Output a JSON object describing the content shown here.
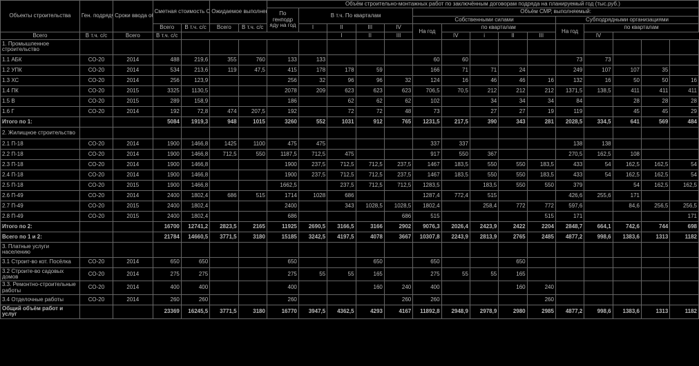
{
  "headers": {
    "obj": "Объекты строительства",
    "gen": "Ген. подрядчик",
    "srok": "Сроки ввода объектов в действие",
    "smeta": "Сметная стоимость СМР (тыс.руб.)",
    "ozhid": "Ожидаемое выполнение СМР на начало планового года",
    "vol_top": "Объём строительно-монтажных работ по заключённым договорам подряда на планируемый год (тыс.руб.)",
    "genpodr": "По генподр яду на год",
    "kvart": "В т.ч. По кварталам",
    "vol_vyp": "Объём СМР, выполняемый:",
    "sobst": "Собственными силами",
    "subpod": "Субподрядными организациями",
    "na_god": "На год",
    "po_kv": "по кварталам",
    "vsego": "Всего",
    "vtcss": "В т.ч. с/с",
    "I": "I",
    "II": "II",
    "III": "III",
    "IV": "IV",
    "i": "i"
  },
  "sections": {
    "s1": "1. Промышленное строительство",
    "s2": "2. Жилищное строительство",
    "s3": "3. Платные услуги населению",
    "it1": "Итого по 1:",
    "it2": "Итого по 2:",
    "it12": "Всего по 1 и 2:",
    "grand": "Общий объём работ и услуг"
  },
  "rows": [
    {
      "n": "1.1 АБК",
      "g": "СО-20",
      "y": "2014",
      "c": [
        "488",
        "219,6",
        "355",
        "760",
        "133",
        "133",
        "",
        "",
        "",
        "60",
        "60",
        "",
        "",
        "",
        "73",
        "73",
        "",
        "",
        ""
      ]
    },
    {
      "n": "1.2 УПК",
      "g": "СО-20",
      "y": "2014",
      "c": [
        "534",
        "213,6",
        "119",
        "47,5",
        "415",
        "178",
        "178",
        "59",
        "",
        "166",
        "71",
        "71",
        "24",
        "",
        "249",
        "107",
        "107",
        "35",
        ""
      ]
    },
    {
      "n": "1.3 ХС",
      "g": "СО-20",
      "y": "2014",
      "c": [
        "256",
        "123,9",
        "",
        "",
        "256",
        "32",
        "96",
        "96",
        "32",
        "124",
        "16",
        "46",
        "46",
        "16",
        "132",
        "16",
        "50",
        "50",
        "16"
      ]
    },
    {
      "n": "1.4 ПК",
      "g": "СО-20",
      "y": "2015",
      "c": [
        "3325",
        "1130,5",
        "",
        "",
        "2078",
        "209",
        "623",
        "623",
        "623",
        "706,5",
        "70,5",
        "212",
        "212",
        "212",
        "1371,5",
        "138,5",
        "411",
        "411",
        "411"
      ]
    },
    {
      "n": "1.5 В",
      "g": "СО-20",
      "y": "2015",
      "c": [
        "289",
        "158,9",
        "",
        "",
        "186",
        "",
        "62",
        "62",
        "62",
        "102",
        "",
        "34",
        "34",
        "34",
        "84",
        "",
        "28",
        "28",
        "28"
      ]
    },
    {
      "n": "1.6 Г",
      "g": "СО-20",
      "y": "2014",
      "c": [
        "192",
        "72,8",
        "474",
        "207,5",
        "192",
        "",
        "72",
        "72",
        "48",
        "73",
        "",
        "27",
        "27",
        "19",
        "119",
        "",
        "45",
        "45",
        "29"
      ]
    }
  ],
  "it1c": [
    "5084",
    "1919,3",
    "948",
    "1015",
    "3260",
    "552",
    "1031",
    "912",
    "765",
    "1231,5",
    "217,5",
    "390",
    "343",
    "281",
    "2028,5",
    "334,5",
    "641",
    "569",
    "484"
  ],
  "rows2": [
    {
      "n": "2.1 П-18",
      "g": "СО-20",
      "y": "2014",
      "c": [
        "1900",
        "1466,8",
        "1425",
        "1100",
        "475",
        "475",
        "",
        "",
        "",
        "337",
        "337",
        "",
        "",
        "",
        "138",
        "138",
        "",
        "",
        ""
      ]
    },
    {
      "n": "2.2 П-18",
      "g": "СО-20",
      "y": "2014",
      "c": [
        "1900",
        "1466,8",
        "712,5",
        "550",
        "1187,5",
        "712,5",
        "475",
        "",
        "",
        "917",
        "550",
        "367",
        "",
        "",
        "270,5",
        "162,5",
        "108",
        "",
        ""
      ]
    },
    {
      "n": "2.3 П-18",
      "g": "СО-20",
      "y": "2014",
      "c": [
        "1900",
        "1466,8",
        "",
        "",
        "1900",
        "237,5",
        "712,5",
        "712,5",
        "237,5",
        "1467",
        "183,5",
        "550",
        "550",
        "183,5",
        "433",
        "54",
        "162,5",
        "162,5",
        "54"
      ]
    },
    {
      "n": "2.4 П-18",
      "g": "СО-20",
      "y": "2014",
      "c": [
        "1900",
        "1466,8",
        "",
        "",
        "1900",
        "237,5",
        "712,5",
        "712,5",
        "237,5",
        "1467",
        "183,5",
        "550",
        "550",
        "183,5",
        "433",
        "54",
        "162,5",
        "162,5",
        "54"
      ]
    },
    {
      "n": "2.5 П-18",
      "g": "СО-20",
      "y": "2015",
      "c": [
        "1900",
        "1466,8",
        "",
        "",
        "1662,5",
        "",
        "237,5",
        "712,5",
        "712,5",
        "1283,5",
        "",
        "183,5",
        "550",
        "550",
        "379",
        "",
        "54",
        "162,5",
        "162,5"
      ]
    },
    {
      "n": "2.6 П-49",
      "g": "СО-20",
      "y": "2014",
      "c": [
        "2400",
        "1802,4",
        "686",
        "515",
        "1714",
        "1028",
        "686",
        "",
        "",
        "1287,4",
        "772,4",
        "515",
        "",
        "",
        "426,6",
        "255,6",
        "171",
        "",
        ""
      ]
    },
    {
      "n": "2.7 П-49",
      "g": "СО-20",
      "y": "2015",
      "c": [
        "2400",
        "1802,4",
        "",
        "",
        "2400",
        "",
        "343",
        "1028,5",
        "1028,5",
        "1802,4",
        "",
        "258,4",
        "772",
        "772",
        "597,6",
        "",
        "84,6",
        "256,5",
        "256,5"
      ]
    },
    {
      "n": "2.8 П-49",
      "g": "СО-20",
      "y": "2015",
      "c": [
        "2400",
        "1802,4",
        "",
        "",
        "686",
        "",
        "",
        "",
        "686",
        "515",
        "",
        "",
        "",
        "515",
        "171",
        "",
        "",
        "",
        "171"
      ]
    }
  ],
  "it2c": [
    "16700",
    "12741,2",
    "2823,5",
    "2165",
    "11925",
    "2690,5",
    "3166,5",
    "3166",
    "2902",
    "9076,3",
    "2026,4",
    "2423,9",
    "2422",
    "2204",
    "2848,7",
    "664,1",
    "742,6",
    "744",
    "698"
  ],
  "it12c": [
    "21784",
    "14660,5",
    "3771,5",
    "3180",
    "15185",
    "3242,5",
    "4197,5",
    "4078",
    "3667",
    "10307,8",
    "2243,9",
    "2813,9",
    "2765",
    "2485",
    "4877,2",
    "998,6",
    "1383,6",
    "1313",
    "1182"
  ],
  "rows3": [
    {
      "n": "3.1 Строит-во кот. Посёлка",
      "g": "СО-20",
      "y": "2014",
      "c": [
        "650",
        "650",
        "",
        "",
        "650",
        "",
        "",
        "650",
        "",
        "650",
        "",
        "",
        "650",
        "",
        "",
        "",
        "",
        "",
        ""
      ]
    },
    {
      "n": "3.2 Строите-во садовых домов",
      "g": "СО-20",
      "y": "2014",
      "c": [
        "275",
        "275",
        "",
        "",
        "275",
        "55",
        "55",
        "165",
        "",
        "275",
        "55",
        "55",
        "165",
        "",
        "",
        "",
        "",
        "",
        ""
      ]
    },
    {
      "n": "3.3. Ремонтно-строительные работы",
      "g": "СО-20",
      "y": "2014",
      "c": [
        "400",
        "400",
        "",
        "",
        "400",
        "",
        "",
        "160",
        "240",
        "400",
        "",
        "",
        "160",
        "240",
        "",
        "",
        "",
        "",
        ""
      ]
    },
    {
      "n": "3.4 Отделочные работы",
      "g": "СО-20",
      "y": "2014",
      "c": [
        "260",
        "260",
        "",
        "",
        "260",
        "",
        "",
        "",
        "260",
        "260",
        "",
        "",
        "",
        "260",
        "",
        "",
        "",
        "",
        ""
      ]
    }
  ],
  "grandc": [
    "23369",
    "16245,5",
    "3771,5",
    "3180",
    "16770",
    "3947,5",
    "4362,5",
    "4293",
    "4167",
    "11892,8",
    "2948,9",
    "2978,9",
    "2980",
    "2985",
    "4877,2",
    "998,6",
    "1383,6",
    "1313",
    "1182"
  ]
}
